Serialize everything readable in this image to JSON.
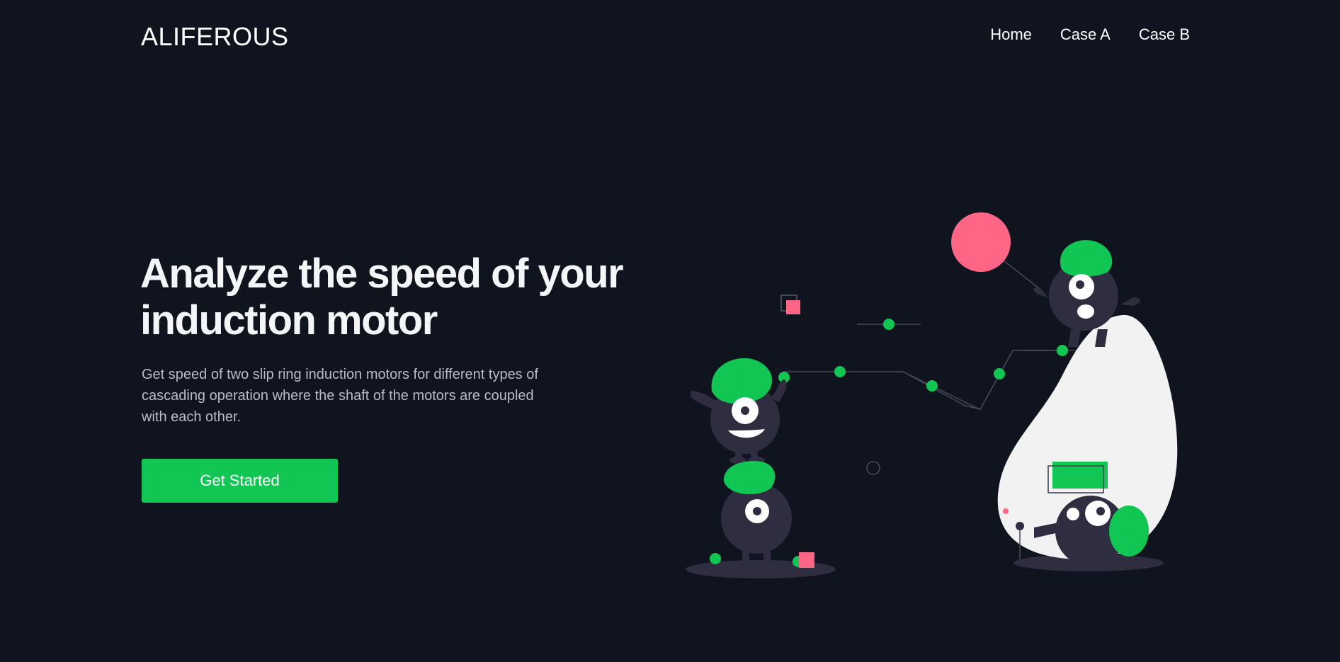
{
  "header": {
    "brand": "ALIFEROUS",
    "nav": [
      {
        "label": "Home"
      },
      {
        "label": "Case A"
      },
      {
        "label": "Case B"
      }
    ]
  },
  "hero": {
    "title_line1": "Analyze the speed of your",
    "title_line2": "induction motor",
    "description": "Get speed of two slip ring induction motors for different types of cascading operation where the shaft of the motors are coupled with each other.",
    "cta_label": "Get Started"
  },
  "colors": {
    "background": "#0f141f",
    "accent_green": "#12c653",
    "accent_pink": "#ff6584",
    "monster": "#2f2e41",
    "blob": "#f2f2f2"
  },
  "illustration": {
    "icon": "monsters-illustration"
  }
}
